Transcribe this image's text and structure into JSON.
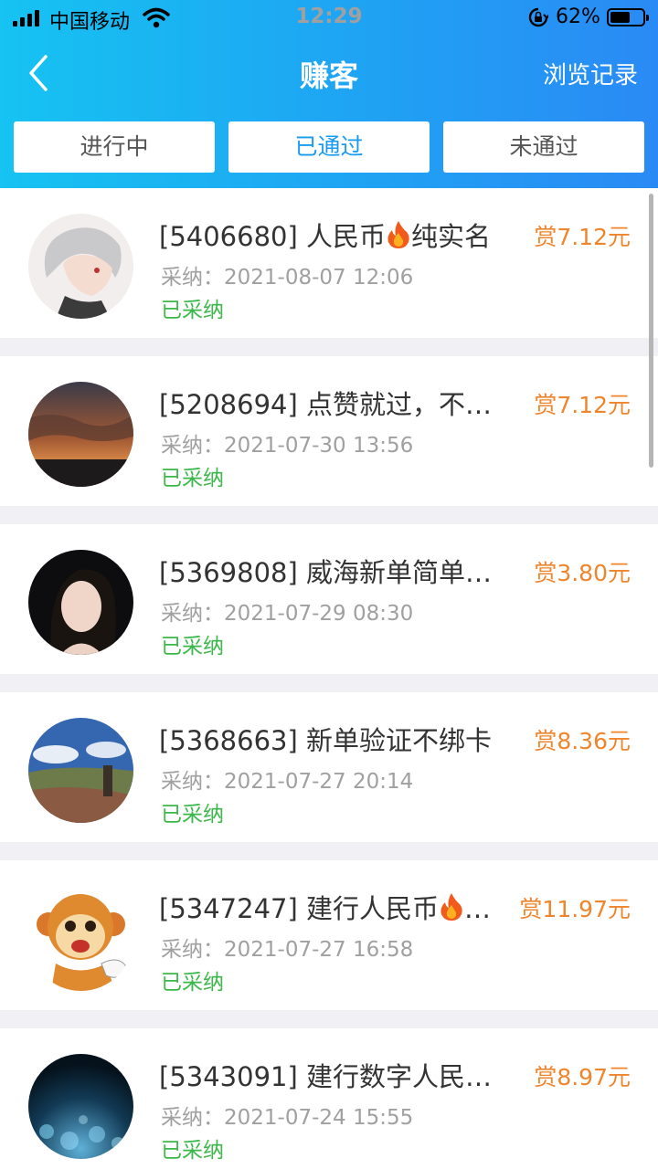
{
  "status_bar": {
    "carrier": "中国移动",
    "time": "12:29",
    "battery_percent": "62%",
    "battery_level": 0.62
  },
  "header": {
    "title": "赚客",
    "history_label": "浏览记录"
  },
  "tabs": [
    {
      "label": "进行中",
      "active": false
    },
    {
      "label": "已通过",
      "active": true
    },
    {
      "label": "未通过",
      "active": false
    }
  ],
  "items": [
    {
      "title_before": "[5406680] 人民币",
      "title_after": "纯实名",
      "flame": true,
      "reward": "赏7.12元",
      "time": "采纳：2021-08-07 12:06",
      "status": "已采纳",
      "avatar_icon": "anime-avatar-icon"
    },
    {
      "title_before": "[5208694] 点赞就过，不…",
      "title_after": "",
      "flame": false,
      "reward": "赏7.12元",
      "time": "采纳：2021-07-30 13:56",
      "status": "已采纳",
      "avatar_icon": "sunset-avatar-icon"
    },
    {
      "title_before": "[5369808] 威海新单简单…",
      "title_after": "",
      "flame": false,
      "reward": "赏3.80元",
      "time": "采纳：2021-07-29 08:30",
      "status": "已采纳",
      "avatar_icon": "portrait-avatar-icon"
    },
    {
      "title_before": "[5368663] 新单验证不绑卡",
      "title_after": "",
      "flame": false,
      "reward": "赏8.36元",
      "time": "采纳：2021-07-27 20:14",
      "status": "已采纳",
      "avatar_icon": "landscape-avatar-icon"
    },
    {
      "title_before": "[5347247] 建行人民币",
      "title_after": "…",
      "flame": true,
      "reward": "赏11.97元",
      "time": "采纳：2021-07-27 16:58",
      "status": "已采纳",
      "avatar_icon": "monkey-avatar-icon"
    },
    {
      "title_before": "[5343091] 建行数字人民…",
      "title_after": "",
      "flame": false,
      "reward": "赏8.97元",
      "time": "采纳：2021-07-24 15:55",
      "status": "已采纳",
      "avatar_icon": "bokeh-avatar-icon"
    }
  ],
  "colors": {
    "accent": "#1a9bf0",
    "reward": "#f0852b",
    "status_ok": "#3cb84a"
  }
}
